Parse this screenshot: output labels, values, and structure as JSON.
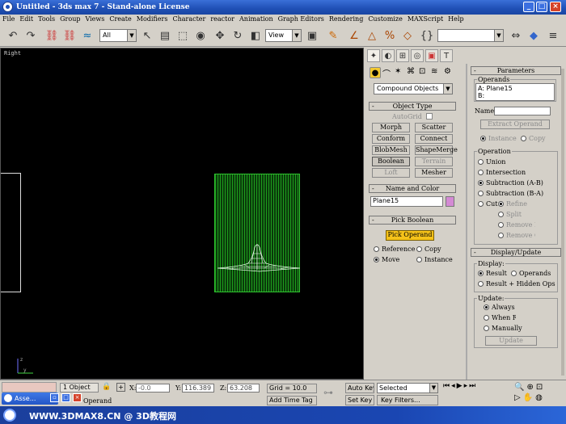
{
  "window": {
    "title": "Untitled   - 3ds max 7   - Stand-alone License"
  },
  "menu": [
    "File",
    "Edit",
    "Tools",
    "Group",
    "Views",
    "Create",
    "Modifiers",
    "Character",
    "reactor",
    "Animation",
    "Graph Editors",
    "Rendering",
    "Customize",
    "MAXScript",
    "Help"
  ],
  "toolbar": {
    "selection_filter": "All",
    "ref_coord": "View",
    "named_selection": ""
  },
  "viewport": {
    "label": "Right"
  },
  "command_panel": {
    "category": "Compound Objects",
    "object_type": {
      "header": "Object Type",
      "autogrid": "AutoGrid",
      "buttons": [
        "Morph",
        "Scatter",
        "Conform",
        "Connect",
        "BlobMesh",
        "ShapeMerge",
        "Boolean",
        "Terrain",
        "Loft",
        "Mesher"
      ]
    },
    "name_color": {
      "header": "Name and Color",
      "name": "Plane15",
      "color": "#d48ad4"
    },
    "pick_boolean": {
      "header": "Pick Boolean",
      "pick_button": "Pick Operand",
      "options": [
        "Reference",
        "Copy",
        "Move",
        "Instance"
      ],
      "selected": "Move"
    }
  },
  "parameters": {
    "header": "Parameters",
    "operands_label": "Operands",
    "operands": [
      "A: Plane15",
      "B:"
    ],
    "name_label": "Name:",
    "name_value": "",
    "extract_button": "Extract Operand",
    "extract_options": [
      "Instance",
      "Copy"
    ],
    "operation_label": "Operation",
    "operations": [
      "Union",
      "Intersection",
      "Subtraction (A-B)",
      "Subtraction (B-A)",
      "Cut"
    ],
    "selected_operation": "Subtraction (A-B)",
    "cut_options": [
      "Refine",
      "Split",
      "Remove Inside",
      "Remove Outside"
    ]
  },
  "display_update": {
    "header": "Display/Update",
    "display_label": "Display:",
    "display_options": [
      "Result",
      "Operands",
      "Result + Hidden Ops"
    ],
    "display_selected": "Result",
    "update_label": "Update:",
    "update_options": [
      "Always",
      "When Rendering",
      "Manually"
    ],
    "update_selected": "Always",
    "update_button": "Update"
  },
  "status": {
    "selection": "1 Object",
    "x_label": "X:",
    "x_value": "-0.0",
    "y_label": "Y:",
    "y_value": "116.389",
    "z_label": "Z:",
    "z_value": "63.208",
    "grid": "Grid = 10.0",
    "prompt": "Operand",
    "add_time_tag": "Add Time Tag",
    "auto_key": "Auto Key",
    "set_key": "Set Key",
    "key_mode": "Selected",
    "key_filters": "Key Filters..."
  },
  "taskbar": {
    "item": "Asse...",
    "watermark": "WWW.3DMAX8.CN @ 3D教程网"
  }
}
